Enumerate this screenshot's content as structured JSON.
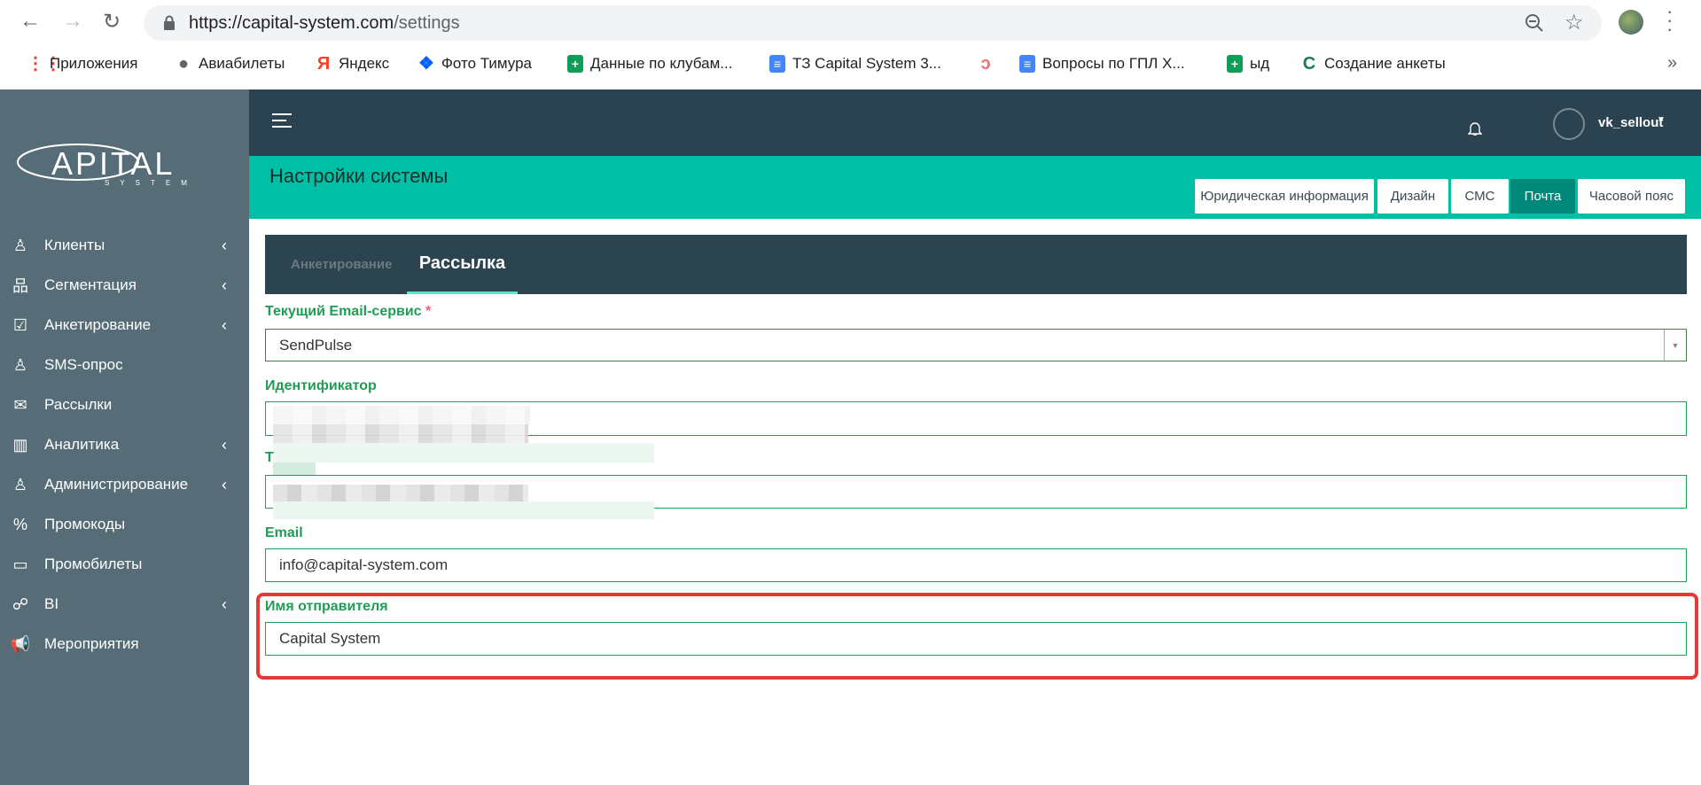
{
  "browser": {
    "url_host": "https://capital-system.com",
    "url_path": "/settings",
    "bookmarks": [
      {
        "label": "Приложения",
        "icon": "apps-grid-icon",
        "color": "#ea4335"
      },
      {
        "label": "Авиабилеты",
        "icon": "globe-icon",
        "color": "#5f6368"
      },
      {
        "label": "Яндекс",
        "icon": "yandex-icon",
        "color": "#fc3f1d"
      },
      {
        "label": "Фото Тимура",
        "icon": "dropbox-icon",
        "color": "#0061fe"
      },
      {
        "label": "Данные по клубам...",
        "icon": "google-sheets-icon",
        "color": "#0f9d58"
      },
      {
        "label": "ТЗ Capital System 3...",
        "icon": "google-docs-icon",
        "color": "#4285f4"
      },
      {
        "label": "",
        "icon": "swirl-icon",
        "color": "#e57373"
      },
      {
        "label": "Вопросы по ГПЛ Х...",
        "icon": "google-docs-icon",
        "color": "#4285f4"
      },
      {
        "label": "ыд",
        "icon": "google-sheets-icon",
        "color": "#0f9d58"
      },
      {
        "label": "Создание анкеты",
        "icon": "c-logo-icon",
        "color": "#1b7a5a"
      }
    ],
    "more": "»"
  },
  "sidebar": {
    "logo": "CAPITAL SYSTEM",
    "items": [
      {
        "label": "Клиенты",
        "icon": "user-icon",
        "expandable": true
      },
      {
        "label": "Сегментация",
        "icon": "hierarchy-icon",
        "expandable": true
      },
      {
        "label": "Анкетирование",
        "icon": "survey-check-icon",
        "expandable": true
      },
      {
        "label": "SMS-опрос",
        "icon": "user-icon",
        "expandable": false
      },
      {
        "label": "Рассылки",
        "icon": "mail-icon",
        "expandable": false
      },
      {
        "label": "Аналитика",
        "icon": "chart-icon",
        "expandable": true
      },
      {
        "label": "Администрирование",
        "icon": "admin-icon",
        "expandable": true
      },
      {
        "label": "Промокоды",
        "icon": "promo-percent-icon",
        "expandable": false
      },
      {
        "label": "Промобилеты",
        "icon": "ticket-icon",
        "expandable": false
      },
      {
        "label": "BI",
        "icon": "graph-nodes-icon",
        "expandable": true
      },
      {
        "label": "Мероприятия",
        "icon": "megaphone-icon",
        "expandable": false
      }
    ]
  },
  "header": {
    "username": "vk_sellout"
  },
  "page": {
    "title": "Настройки системы",
    "buttons": [
      "Юридическая информация",
      "Дизайн",
      "СМС",
      "Почта",
      "Часовой пояс"
    ],
    "active_button": "Почта"
  },
  "tabs": [
    {
      "label": "Анкетирование",
      "active": false
    },
    {
      "label": "Рассылка",
      "active": true
    }
  ],
  "form": {
    "service_label": "Текущий Email-сервис",
    "required_mark": "*",
    "service_value": "SendPulse",
    "id_label": "Идентификатор",
    "token_label": "Т",
    "email_label": "Email",
    "email_value": "info@capital-system.com",
    "sender_label": "Имя отправителя",
    "sender_value": "Capital System"
  },
  "colors": {
    "sidebar": "#566d78",
    "header": "#2b4350",
    "accent": "#00bfa5",
    "active_button": "#00897b",
    "label": "#1f9d55",
    "highlight": "#e53935"
  }
}
